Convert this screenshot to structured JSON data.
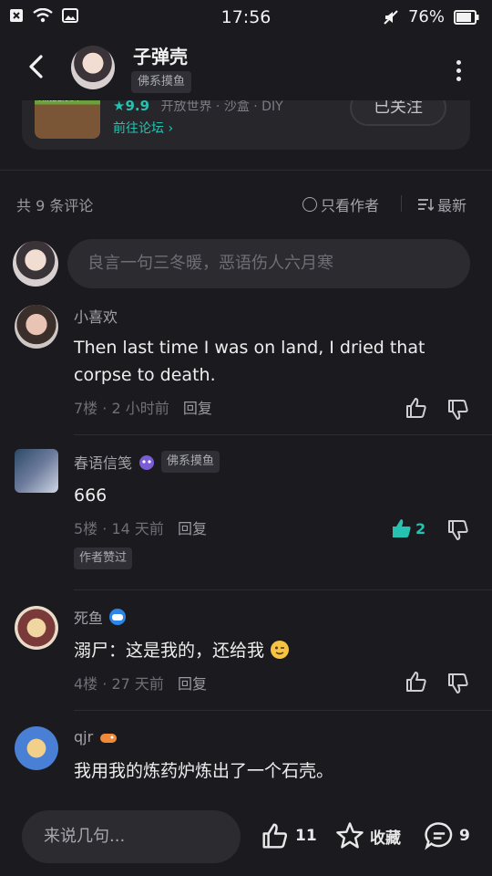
{
  "status_bar": {
    "time": "17:56",
    "battery": "76%"
  },
  "header": {
    "author_name": "子弹壳",
    "author_tag": "佛系摸鱼"
  },
  "game_card": {
    "icon_text": "MINECRAFT",
    "score": "★9.9",
    "tags": "开放世界 · 沙盒 · DIY",
    "forum_link": "前往论坛 ›",
    "follow_label": "已关注"
  },
  "comments_bar": {
    "count": "共 9 条评论",
    "only_author": "只看作者",
    "sort": "最新",
    "input_placeholder": "良言一句三冬暖，恶语伤人六月寒"
  },
  "comments": [
    {
      "name": "小喜欢",
      "tag": "",
      "text": "Then last time I was on land, I dried that corpse to death.",
      "floor": "7楼",
      "time": "2 小时前",
      "reply": "回复",
      "likes": ""
    },
    {
      "name": "春语信笺",
      "tag": "佛系摸鱼",
      "text": "666",
      "floor": "5楼",
      "time": "14 天前",
      "reply": "回复",
      "likes": "2",
      "author_liked": "作者赞过"
    },
    {
      "name": "死鱼",
      "tag": "",
      "text": "溺尸：这是我的，还给我",
      "floor": "4楼",
      "time": "27 天前",
      "reply": "回复",
      "likes": ""
    },
    {
      "name": "qjr",
      "tag": "",
      "text": "我用我的炼药炉炼出了一个石壳。",
      "floor": "",
      "time": "",
      "reply": "",
      "likes": ""
    }
  ],
  "bottom_bar": {
    "input_placeholder": "来说几句...",
    "likes": "11",
    "favorite_label": "收藏",
    "comments": "9"
  },
  "colors": {
    "accent": "#27c1b1",
    "background": "#1b1b1f"
  }
}
